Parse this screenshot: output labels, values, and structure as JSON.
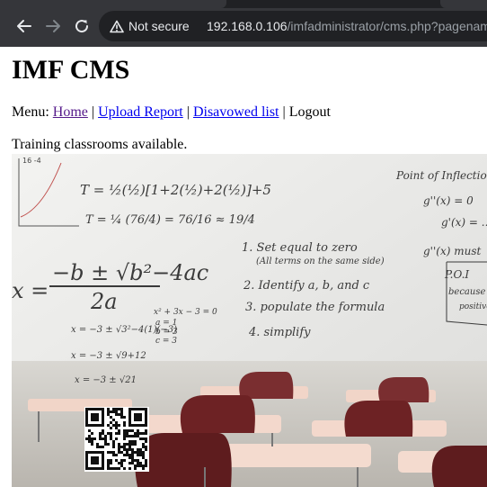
{
  "browser": {
    "security_label": "Not secure",
    "url_host": "192.168.0.106",
    "url_path": "/imfadministrator/cms.php?pagename"
  },
  "page": {
    "title": "IMF CMS",
    "menu_prefix": "Menu:",
    "menu_links": [
      {
        "label": "Home",
        "visited": true
      },
      {
        "label": "Upload Report",
        "visited": false
      },
      {
        "label": "Disavowed list",
        "visited": false
      }
    ],
    "separator": "|",
    "logout_label": "Logout",
    "intro_text": "Training classrooms available."
  },
  "whiteboard": {
    "steps": [
      "1. Set equal to zero",
      "(All terms on the same side)",
      "2. Identify a, b, and c",
      "3. populate the formula",
      "4. simplify"
    ],
    "right_title": "Point of Inflection",
    "right_lines": [
      "g''(x) = 0",
      "g'(x) = ...",
      "g''(x) must",
      "P.O.I",
      "because",
      "positive"
    ]
  },
  "colors": {
    "chrome_bg": "#35363a",
    "omnibox_bg": "#202124",
    "link": "#0000ee",
    "link_visited": "#551a8b"
  }
}
